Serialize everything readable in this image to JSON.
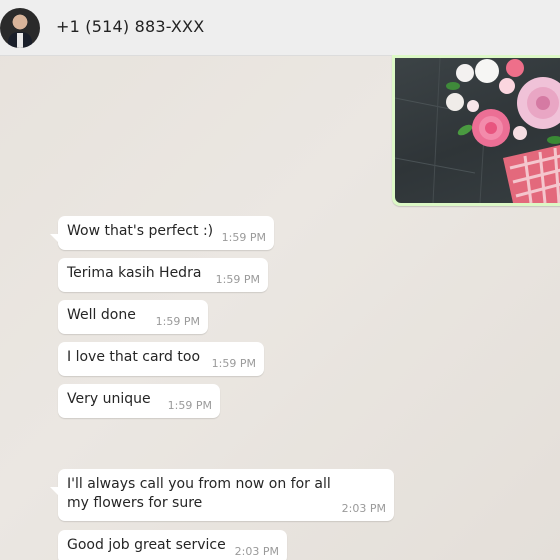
{
  "header": {
    "contact_name": "+1 (514) 883-XXX"
  },
  "messages": [
    {
      "text": "Wow that's perfect :)",
      "time": "1:59 PM"
    },
    {
      "text": "Terima kasih Hedra",
      "time": "1:59 PM"
    },
    {
      "text": "Well done",
      "time": "1:59 PM"
    },
    {
      "text": "I love that card too",
      "time": "1:59 PM"
    },
    {
      "text": "Very unique",
      "time": "1:59 PM"
    },
    {
      "text": "I'll always call you from now on for all my flowers for sure",
      "time": "2:03 PM"
    },
    {
      "text": "Good job great service",
      "time": "2:03 PM"
    }
  ],
  "colors": {
    "outgoing_bubble": "#dcf8c6",
    "incoming_bubble": "#ffffff",
    "header_bg": "#eeeeee"
  },
  "icons": {
    "avatar": "contact-avatar-photo"
  }
}
